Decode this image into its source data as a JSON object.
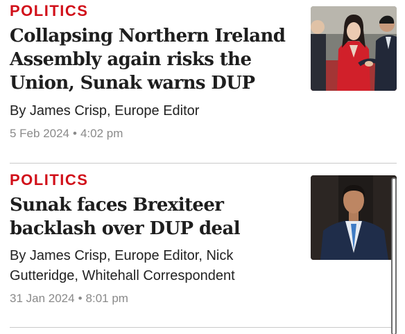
{
  "articles": [
    {
      "section": "POLITICS",
      "headline": "Collapsing Northern Ireland Assembly again risks the Union, Sunak warns DUP",
      "byline": "By James Crisp, Europe Editor",
      "date": "5 Feb 2024",
      "time": "4:02 pm"
    },
    {
      "section": "POLITICS",
      "headline": "Sunak faces Brexiteer backlash over DUP deal",
      "byline": "By James Crisp, Europe Editor, Nick Gutteridge, Whitehall Correspondent",
      "date": "31 Jan 2024",
      "time": "8:01 pm"
    }
  ],
  "meta_separator": "•",
  "colors": {
    "section": "#d1101a",
    "meta": "#8a8a8a",
    "divider": "#c9c9c9"
  }
}
